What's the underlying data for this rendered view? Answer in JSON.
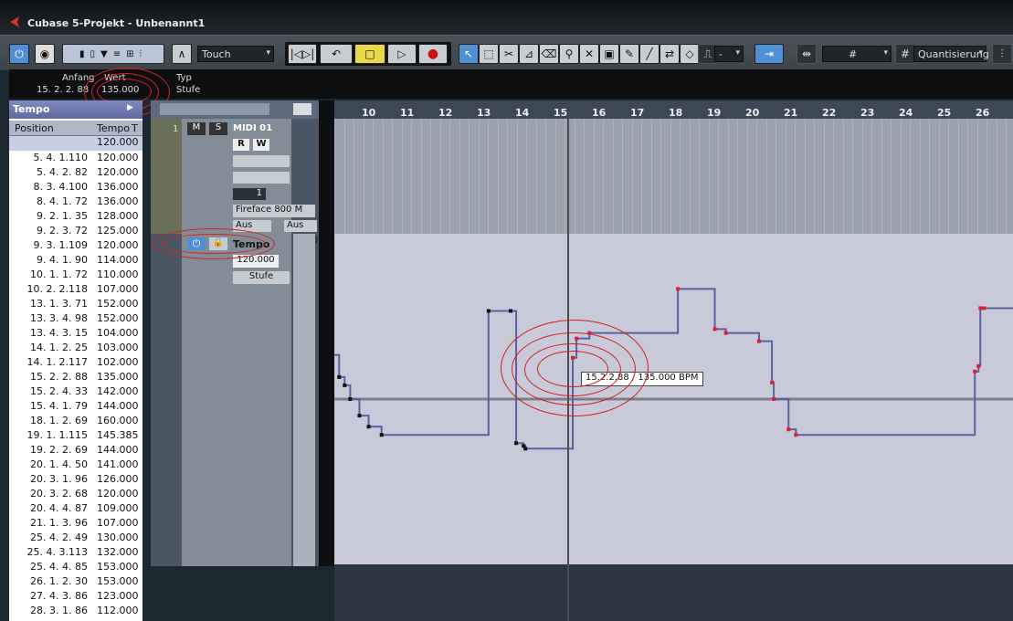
{
  "window": {
    "title": "Cubase 5-Projekt - Unbenannt1"
  },
  "toolbar": {
    "automation_mode": "Touch",
    "snap_value": "-",
    "quantize_label": "Quantisierung"
  },
  "info_line": {
    "headers": [
      "Anfang",
      "Wert",
      "Typ"
    ],
    "values": [
      "15. 2. 2. 88",
      "135.000",
      "Stufe"
    ]
  },
  "tempo_panel": {
    "title": "Tempo",
    "columns": [
      "Position",
      "Tempo",
      "T"
    ],
    "first_value": "120.000",
    "rows": [
      [
        "5. 4. 1.110",
        "120.000"
      ],
      [
        "5. 4. 2. 82",
        "120.000"
      ],
      [
        "8. 3. 4.100",
        "136.000"
      ],
      [
        "8. 4. 1. 72",
        "136.000"
      ],
      [
        "9. 2. 1. 35",
        "128.000"
      ],
      [
        "9. 2. 3. 72",
        "125.000"
      ],
      [
        "9. 3. 1.109",
        "120.000"
      ],
      [
        "9. 4. 1. 90",
        "114.000"
      ],
      [
        "10. 1. 1. 72",
        "110.000"
      ],
      [
        "10. 2. 2.118",
        "107.000"
      ],
      [
        "13. 1. 3. 71",
        "152.000"
      ],
      [
        "13. 3. 4. 98",
        "152.000"
      ],
      [
        "13. 4. 3. 15",
        "104.000"
      ],
      [
        "14. 1. 2. 25",
        "103.000"
      ],
      [
        "14. 1. 2.117",
        "102.000"
      ],
      [
        "15. 2. 2. 88",
        "135.000"
      ],
      [
        "15. 2. 4. 33",
        "142.000"
      ],
      [
        "15. 4. 1. 79",
        "144.000"
      ],
      [
        "18. 1. 2. 69",
        "160.000"
      ],
      [
        "19. 1. 1.115",
        "145.385"
      ],
      [
        "19. 2. 2. 69",
        "144.000"
      ],
      [
        "20. 1. 4. 50",
        "141.000"
      ],
      [
        "20. 3. 1. 96",
        "126.000"
      ],
      [
        "20. 3. 2. 68",
        "120.000"
      ],
      [
        "20. 4. 4. 87",
        "109.000"
      ],
      [
        "21. 1. 3. 96",
        "107.000"
      ],
      [
        "25. 4. 2. 49",
        "130.000"
      ],
      [
        "25. 4. 3.113",
        "132.000"
      ],
      [
        "25. 4. 4. 85",
        "153.000"
      ],
      [
        "26. 1. 2. 30",
        "153.000"
      ],
      [
        "27. 4. 3. 86",
        "123.000"
      ],
      [
        "28. 3. 1. 86",
        "112.000"
      ]
    ]
  },
  "tracks": {
    "midi": {
      "number": "1",
      "name": "MIDI 01",
      "btn_m": "M",
      "btn_s": "S",
      "btn_r": "R",
      "btn_w": "W",
      "channel": "1",
      "output": "Fireface 800 M",
      "send_left": "Aus",
      "send_right": "Aus"
    },
    "tempo": {
      "name": "Tempo",
      "value": "120.000",
      "mode": "Stufe",
      "scale_top": "180",
      "scale_bottom": "60"
    }
  },
  "ruler": {
    "bars": [
      "10",
      "11",
      "12",
      "13",
      "14",
      "15",
      "16",
      "17",
      "18",
      "19",
      "20",
      "21",
      "22",
      "23",
      "24",
      "25",
      "26"
    ]
  },
  "tooltip": {
    "text": "15.2.2.88 / 135.000 BPM"
  }
}
